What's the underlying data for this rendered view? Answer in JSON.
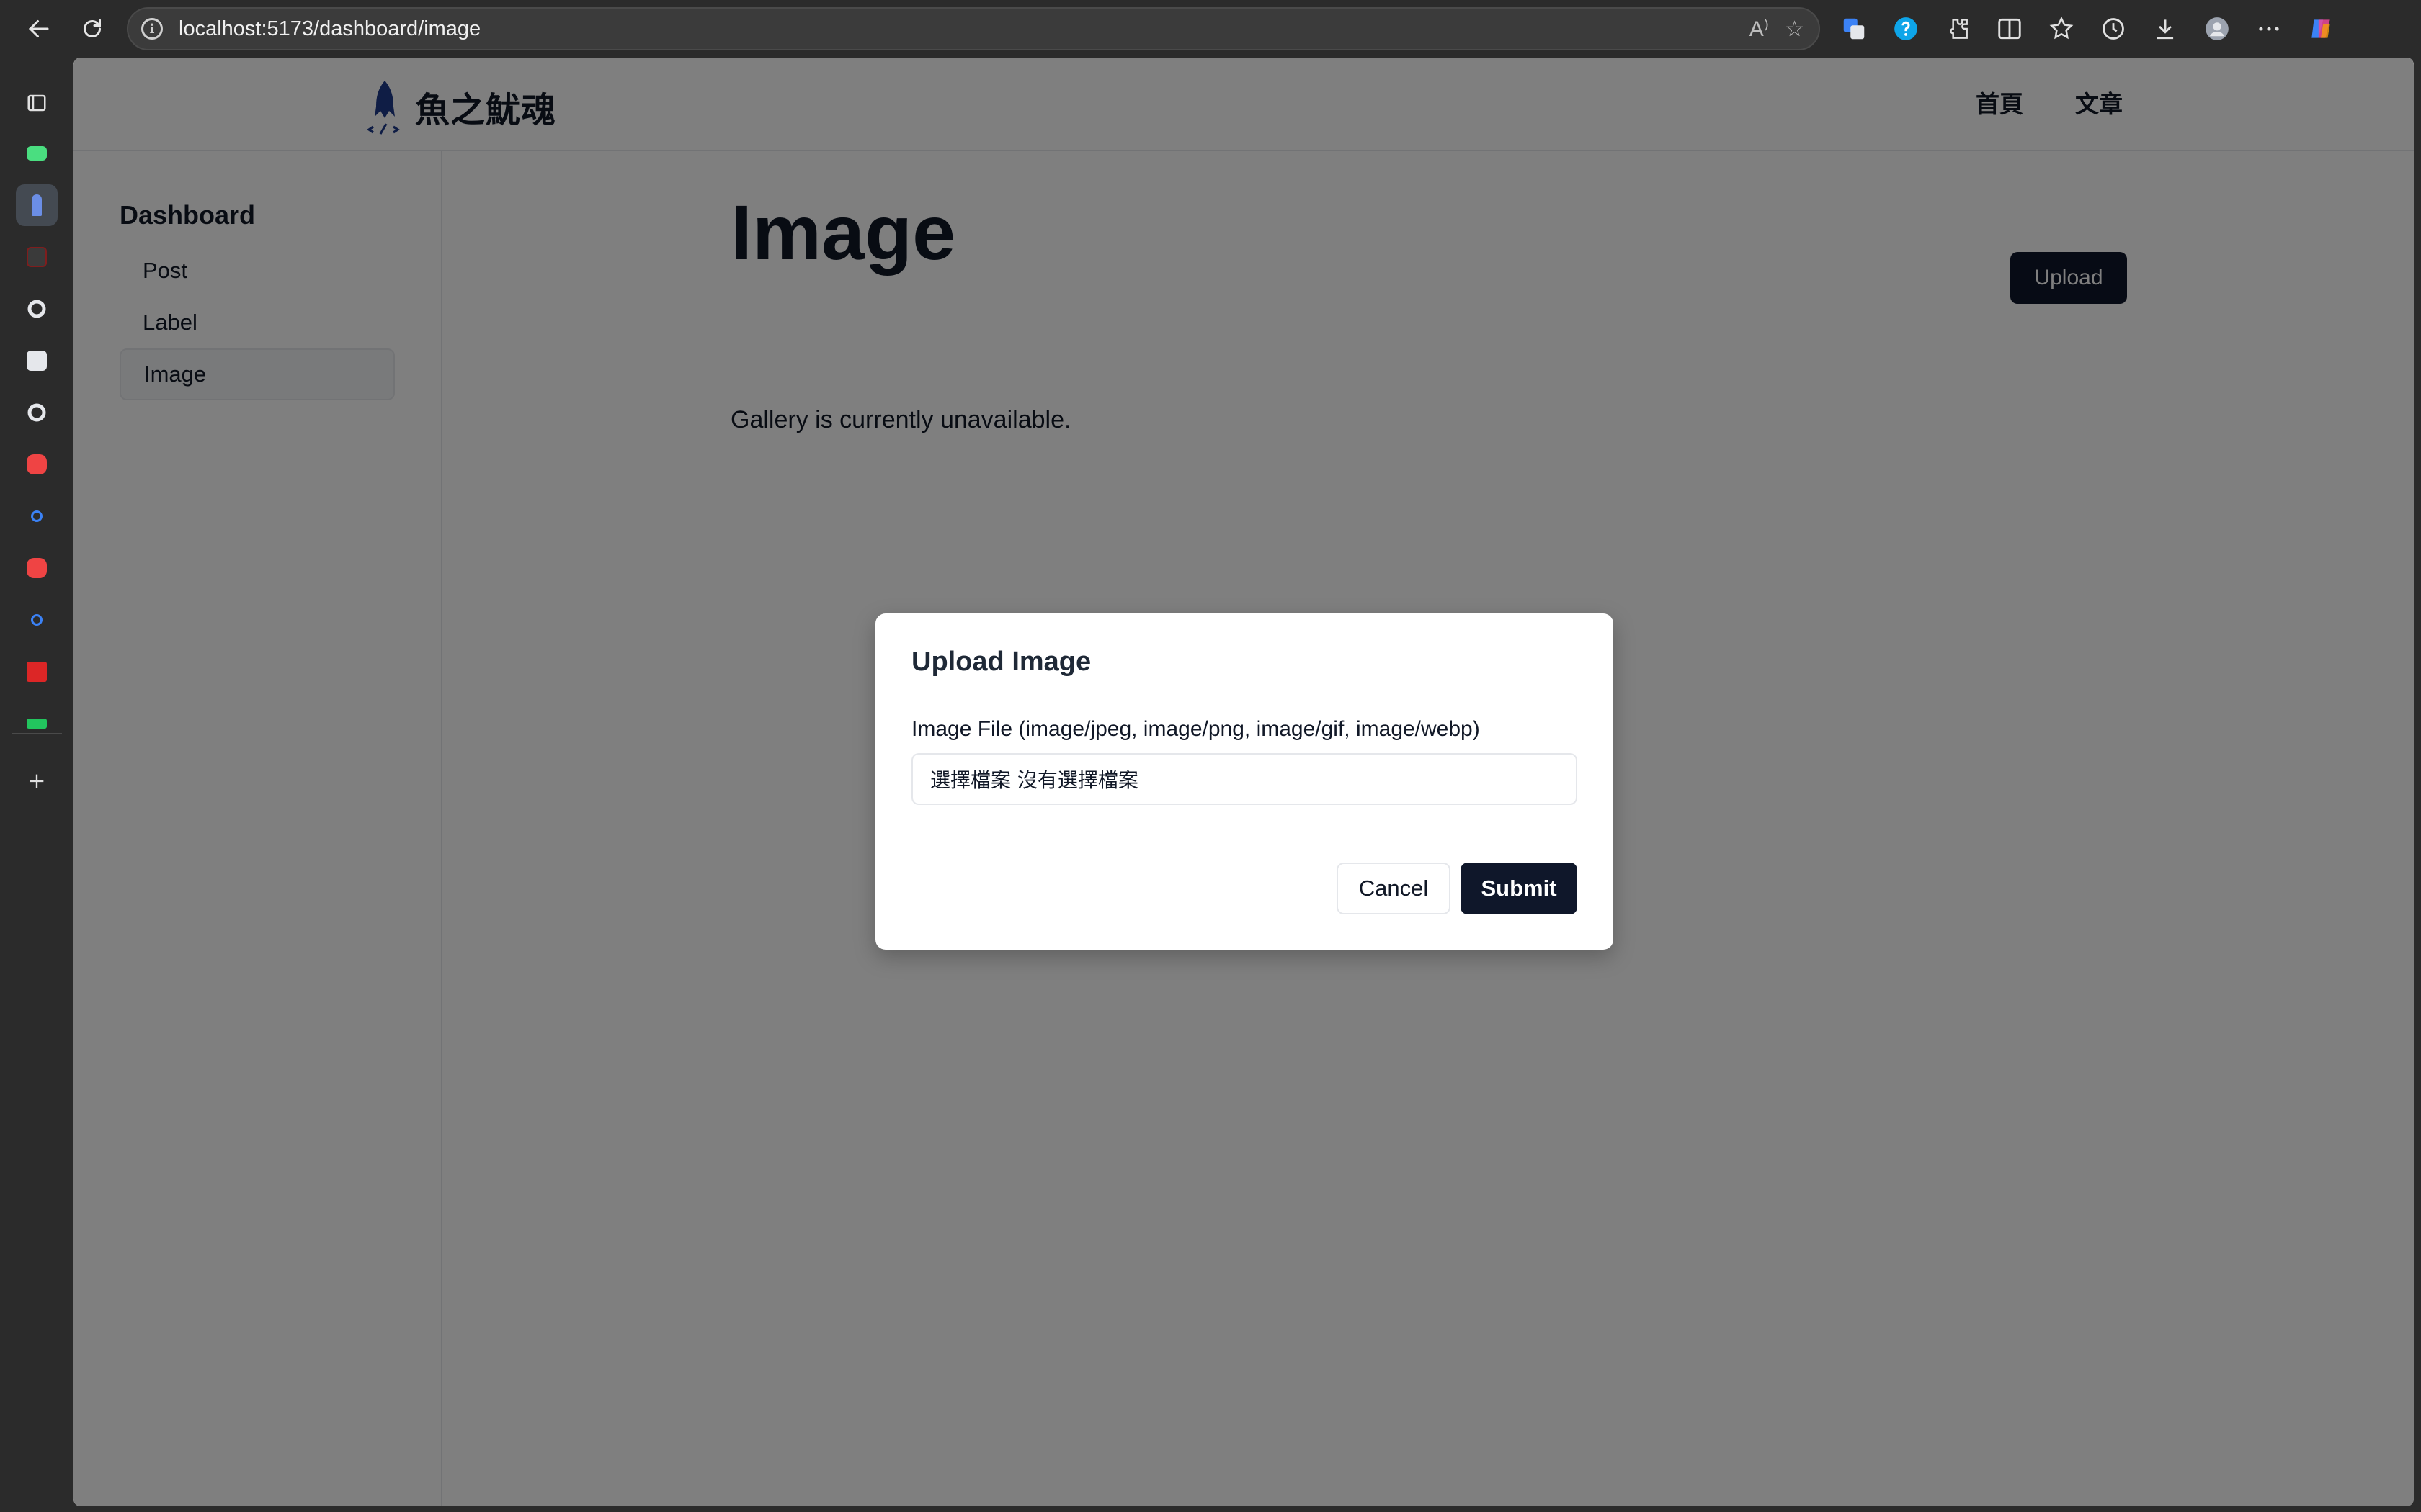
{
  "browser": {
    "url": "localhost:5173/dashboard/image",
    "read_aloud_label": "A⁾"
  },
  "site": {
    "name": "魚之魷魂",
    "nav": [
      {
        "label": "首頁"
      },
      {
        "label": "文章"
      }
    ]
  },
  "dashboard": {
    "title": "Dashboard",
    "items": [
      {
        "label": "Post"
      },
      {
        "label": "Label"
      },
      {
        "label": "Image"
      }
    ],
    "active_item": "Image"
  },
  "main": {
    "title": "Image",
    "upload_label": "Upload",
    "gallery_message": "Gallery is currently unavailable."
  },
  "modal": {
    "title": "Upload Image",
    "field_label": "Image File (image/jpeg, image/png, image/gif, image/webp)",
    "file_input_text": "選擇檔案 沒有選擇檔案",
    "cancel_label": "Cancel",
    "submit_label": "Submit"
  },
  "colors": {
    "primary_button": "#0f172a",
    "overlay": "rgba(0,0,0,0.5)",
    "logo_blue": "#1e3a8a"
  }
}
